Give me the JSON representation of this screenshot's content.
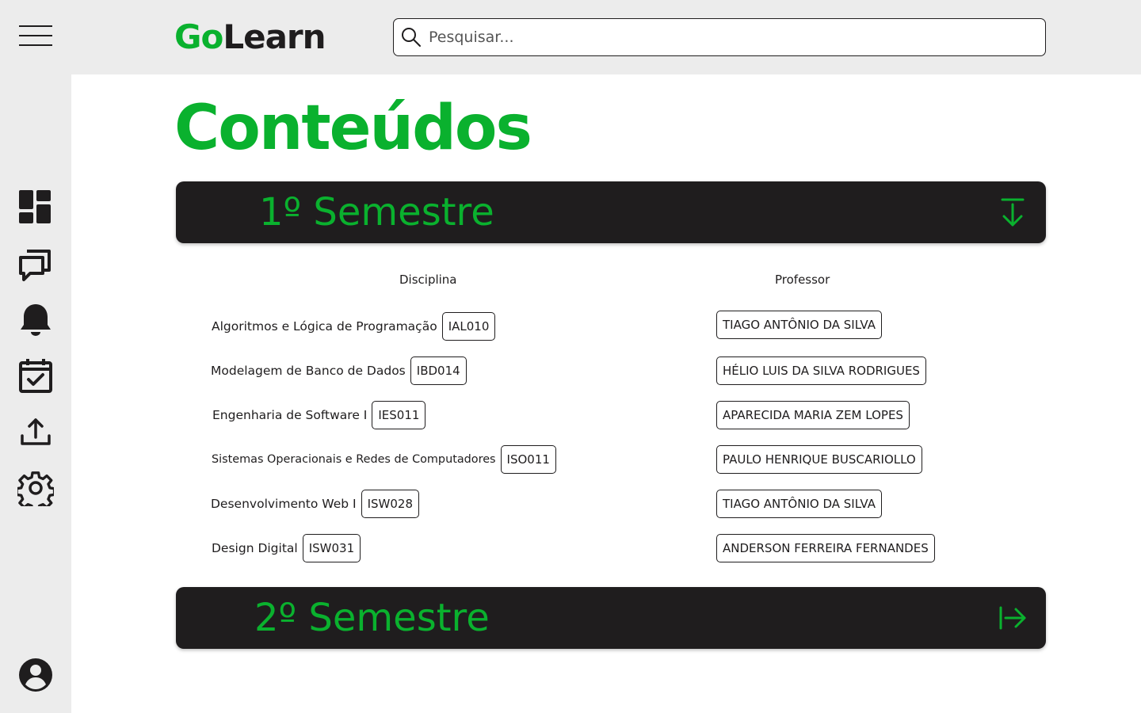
{
  "app": {
    "logo_part1": "Go",
    "logo_part2": "Learn"
  },
  "search": {
    "placeholder": "Pesquisar..."
  },
  "sidebar": {
    "items": [
      {
        "icon": "menu-icon"
      },
      {
        "icon": "dashboard-icon"
      },
      {
        "icon": "chat-icon"
      },
      {
        "icon": "bell-icon"
      },
      {
        "icon": "calendar-check-icon"
      },
      {
        "icon": "upload-icon"
      },
      {
        "icon": "gear-icon"
      },
      {
        "icon": "user-avatar-icon"
      }
    ]
  },
  "page": {
    "title": "Conteúdos"
  },
  "semesters": [
    {
      "label": "1º Semestre",
      "expanded": true,
      "arrow_icon": "arrow-down-icon",
      "columns": {
        "discipline": "Disciplina",
        "professor": "Professor"
      },
      "rows": [
        {
          "discipline": "Algoritmos e Lógica de Programação",
          "code": "IAL010",
          "professor": "TIAGO ANTÔNIO DA SILVA"
        },
        {
          "discipline": "Modelagem de Banco de Dados",
          "code": "IBD014",
          "professor": "HÉLIO LUIS DA SILVA RODRIGUES"
        },
        {
          "discipline": "Engenharia de Software I",
          "code": "IES011",
          "professor": "APARECIDA MARIA ZEM LOPES"
        },
        {
          "discipline": "Sistemas Operacionais e Redes de Computadores",
          "code": "ISO011",
          "professor": "PAULO HENRIQUE BUSCARIOLLO"
        },
        {
          "discipline": "Desenvolvimento Web I",
          "code": "ISW028",
          "professor": "TIAGO ANTÔNIO DA SILVA"
        },
        {
          "discipline": "Design Digital",
          "code": "ISW031",
          "professor": "ANDERSON FERREIRA FERNANDES"
        }
      ]
    },
    {
      "label": "2º Semestre",
      "expanded": false,
      "arrow_icon": "arrow-right-bar-icon"
    }
  ],
  "colors": {
    "brand_green": "#0ab12e",
    "dark": "#1f1d1e",
    "sidebar_bg": "#ececec"
  }
}
